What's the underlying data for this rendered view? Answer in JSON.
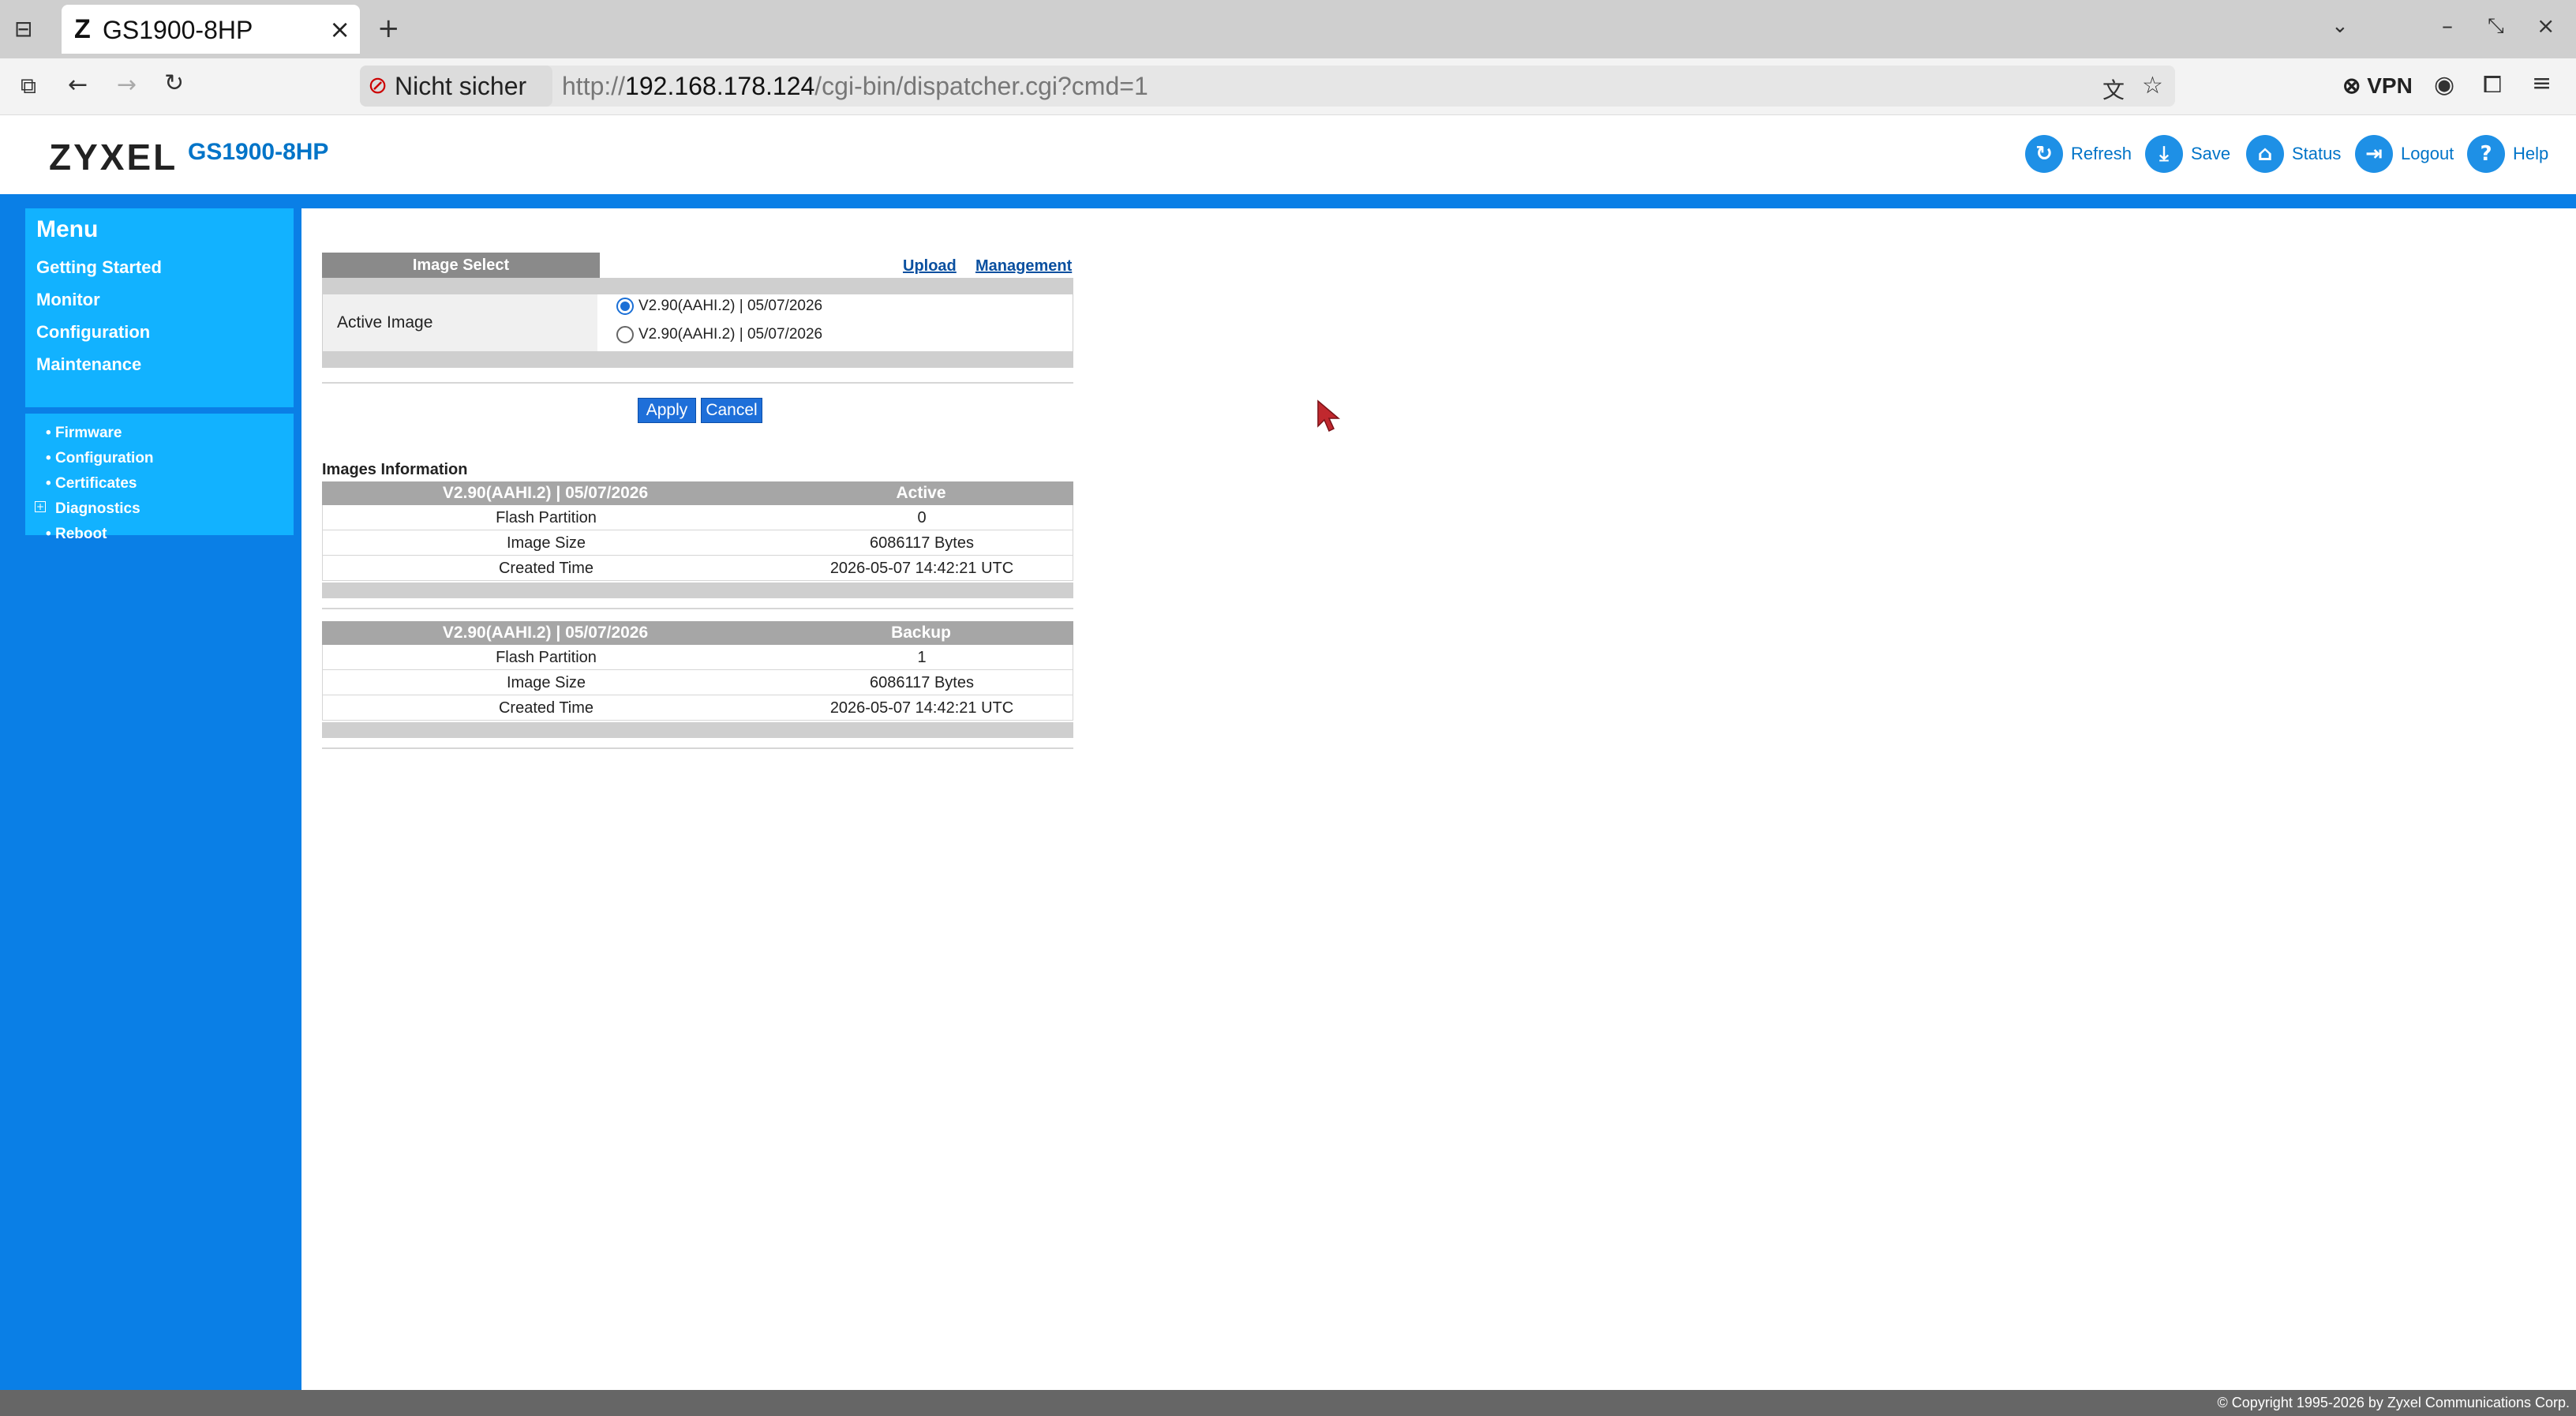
{
  "browser": {
    "tab_title": "GS1900-8HP",
    "tab_favicon": "Z",
    "security_label": "Nicht sicher",
    "url_prefix": "http://",
    "url_host": "192.168.178.124",
    "url_path": "/cgi-bin/dispatcher.cgi?cmd=1",
    "vpn_label": "VPN"
  },
  "header": {
    "logo": "ZYXEL",
    "model": "GS1900-8HP",
    "buttons": {
      "refresh": "Refresh",
      "save": "Save",
      "status": "Status",
      "logout": "Logout",
      "help": "Help"
    }
  },
  "sidebar": {
    "title": "Menu",
    "items": [
      "Getting Started",
      "Monitor",
      "Configuration",
      "Maintenance"
    ],
    "subitems": [
      "Firmware",
      "Configuration",
      "Certificates",
      "Diagnostics",
      "Reboot"
    ]
  },
  "image_select": {
    "header": "Image Select",
    "links": {
      "upload": "Upload",
      "management": "Management"
    },
    "active_image_label": "Active Image",
    "options": [
      "V2.90(AAHI.2) | 05/07/2026",
      "V2.90(AAHI.2) | 05/07/2026"
    ],
    "selected_index": 0,
    "apply_label": "Apply",
    "cancel_label": "Cancel"
  },
  "images_info": {
    "title": "Images Information",
    "tables": [
      {
        "version": "V2.90(AAHI.2) | 05/07/2026",
        "state": "Active",
        "rows": [
          {
            "label": "Flash Partition",
            "value": "0"
          },
          {
            "label": "Image Size",
            "value": "6086117 Bytes"
          },
          {
            "label": "Created Time",
            "value": "2026-05-07 14:42:21 UTC"
          }
        ]
      },
      {
        "version": "V2.90(AAHI.2) | 05/07/2026",
        "state": "Backup",
        "rows": [
          {
            "label": "Flash Partition",
            "value": "1"
          },
          {
            "label": "Image Size",
            "value": "6086117 Bytes"
          },
          {
            "label": "Created Time",
            "value": "2026-05-07 14:42:21 UTC"
          }
        ]
      }
    ]
  },
  "footer": {
    "copyright": "© Copyright 1995-2026 by Zyxel Communications Corp."
  },
  "colors": {
    "accent": "#0a7fe6",
    "menu_panel": "#12b2ff",
    "header_text": "#0074c8"
  }
}
